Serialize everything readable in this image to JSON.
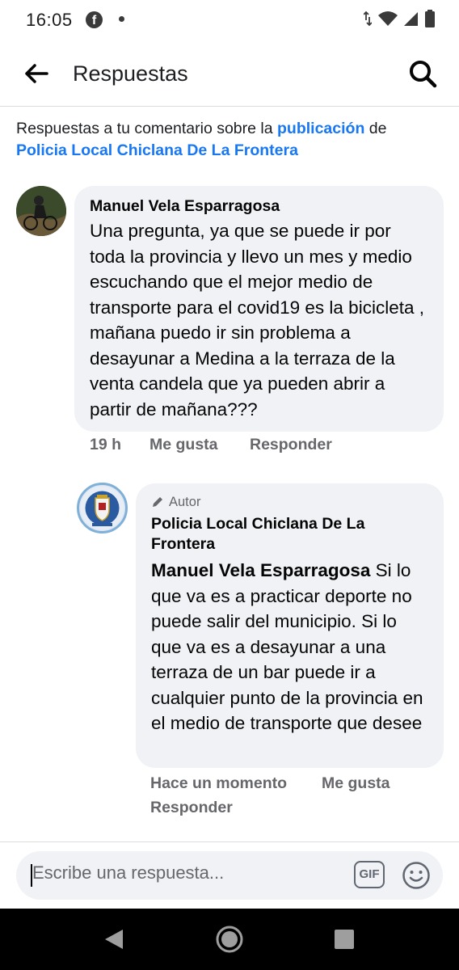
{
  "status_bar": {
    "time": "16:05",
    "notification_icons": [
      "facebook-icon",
      "dot-icon"
    ],
    "system_icons": [
      "data-arrows-icon",
      "wifi-icon",
      "signal-icon",
      "battery-icon"
    ]
  },
  "header": {
    "title": "Respuestas",
    "back_icon": "arrow-left-icon",
    "search_icon": "search-icon"
  },
  "context": {
    "prefix": "Respuestas a tu comentario sobre la ",
    "link": "publicación",
    "middle": " de",
    "page_name": "Policia Local Chiclana De La Frontera"
  },
  "comment": {
    "author": "Manuel Vela Esparragosa",
    "text": "Una pregunta, ya que se puede ir por toda la provincia y llevo un mes y medio escuchando que el mejor medio de transporte para el covid19 es la bicicleta , mañana puedo ir sin problema a desayunar a Medina a la terraza de la venta candela que ya pueden abrir a partir de mañana???",
    "time": "19 h",
    "like": "Me gusta",
    "reply": "Responder"
  },
  "reply": {
    "badge": "Autor",
    "badge_icon": "pencil-icon",
    "author": "Policia Local Chiclana De La Frontera",
    "mention": "Manuel Vela Esparragosa",
    "text": " Si lo que va es a practicar deporte no puede salir del municipio. Si lo que va es a desayunar a una terraza de un bar puede ir a cualquier punto de la provincia en el medio de transporte que desee",
    "time": "Hace un momento",
    "like": "Me gusta",
    "reply": "Responder"
  },
  "composer": {
    "placeholder": "Escribe una respuesta...",
    "gif_label": "GIF",
    "emoji_icon": "smiley-icon"
  },
  "nav": {
    "icons": [
      "nav-back-icon",
      "nav-home-icon",
      "nav-recents-icon"
    ]
  },
  "colors": {
    "link": "#1877f2",
    "bubble": "#f0f2f5",
    "secondary_text": "#65676b"
  }
}
